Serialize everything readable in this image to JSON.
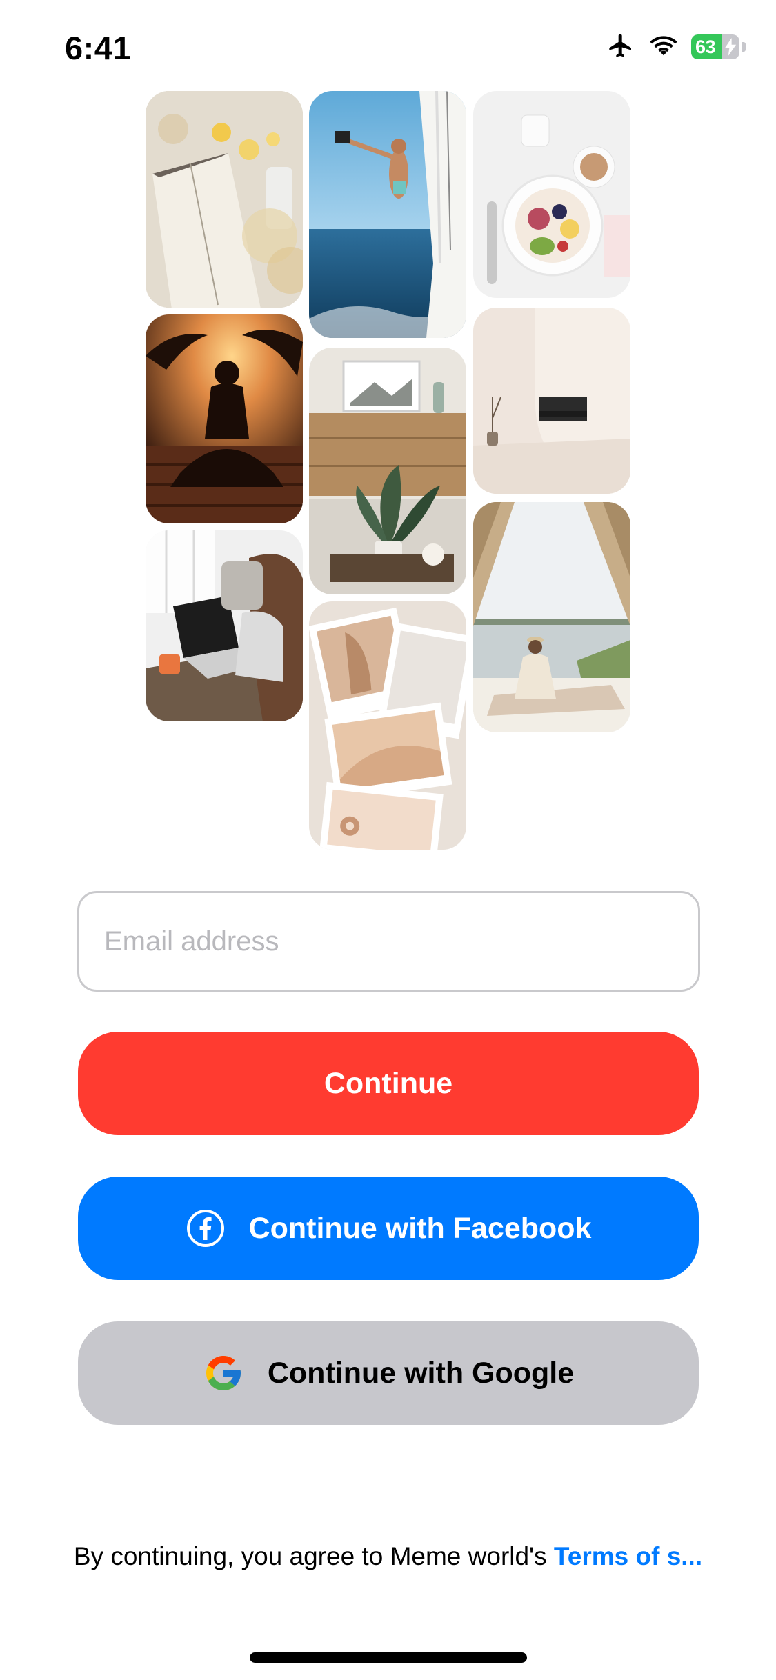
{
  "status_bar": {
    "time": "6:41",
    "battery_percent": "63",
    "battery_level": 0.63,
    "icons": [
      "airplane-icon",
      "wifi-icon",
      "battery-charging-icon"
    ]
  },
  "photo_grid": {
    "tiles": [
      {
        "name": "photo-book-flowers"
      },
      {
        "name": "photo-sailboat-man"
      },
      {
        "name": "photo-breakfast-bowl"
      },
      {
        "name": "photo-meditation-sunset"
      },
      {
        "name": "photo-living-room-shelf"
      },
      {
        "name": "photo-minimal-room"
      },
      {
        "name": "photo-woman-laptop"
      },
      {
        "name": "photo-polaroid-collage"
      },
      {
        "name": "photo-tent-lake"
      }
    ]
  },
  "form": {
    "email_placeholder": "Email address",
    "email_value": "",
    "continue_label": "Continue",
    "facebook_label": "Continue with Facebook",
    "google_label": "Continue with Google"
  },
  "terms": {
    "prefix": "By continuing, you agree to Meme world's ",
    "link": "Terms of s..."
  },
  "colors": {
    "continue": "#ff3b30",
    "facebook": "#007aff",
    "google_bg": "#c7c7cc",
    "link": "#007aff"
  }
}
